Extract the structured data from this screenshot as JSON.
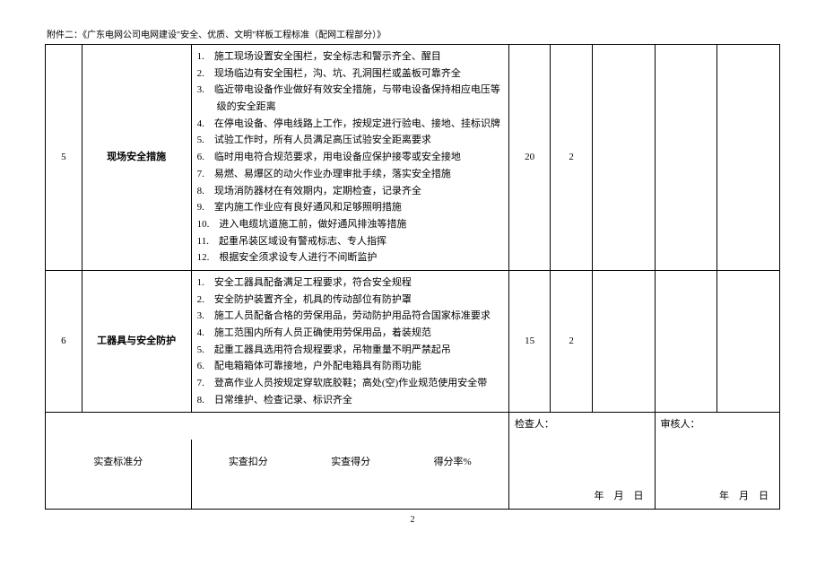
{
  "header": "附件二：《广东电网公司电网建设\"安全、优质、文明\"样板工程标准（配网工程部分）》",
  "rows": [
    {
      "idx": "5",
      "title": "现场安全措施",
      "items": [
        "施工现场设置安全围栏，安全标志和警示齐全、醒目",
        "现场临边有安全围栏，沟、坑、孔洞围栏或盖板可靠齐全",
        "临近带电设备作业做好有效安全措施，与带电设备保持相应电压等级的安全距离",
        "在停电设备、停电线路上工作，按规定进行验电、接地、挂标识牌",
        "试验工作时，所有人员满足高压试验安全距离要求",
        "临时用电符合规范要求，用电设备应保护接零或安全接地",
        "易燃、易爆区的动火作业办理审批手续，落实安全措施",
        "现场消防器材在有效期内，定期检查，记录齐全",
        "室内施工作业应有良好通风和足够照明措施",
        "进入电缆坑道施工前，做好通风排浊等措施",
        "起重吊装区域设有警戒标志、专人指挥",
        "根据安全须求设专人进行不间断监护"
      ],
      "score": "20",
      "min": "2"
    },
    {
      "idx": "6",
      "title": "工器具与安全防护",
      "items": [
        "安全工器具配备满足工程要求，符合安全规程",
        "安全防护装置齐全，机具的传动部位有防护罩",
        "施工人员配备合格的劳保用品，劳动防护用品符合国家标准要求",
        "施工范围内所有人员正确使用劳保用品，着装规范",
        "起重工器具选用符合规程要求，吊物重量不明严禁起吊",
        "配电箱箱体可靠接地，户外配电箱具有防雨功能",
        "登高作业人员按规定穿软底胶鞋；高处(空)作业规范使用安全带",
        "日常维护、检查记录、标识齐全"
      ],
      "score": "15",
      "min": "2"
    }
  ],
  "signatures": {
    "inspector_label": "检查人：",
    "auditor_label": "审核人："
  },
  "summary": {
    "std_score": "实查标准分",
    "deduct": "实查扣分",
    "got": "实查得分",
    "rate": "得分率%"
  },
  "date_text": "年　月　日",
  "page_number": "2"
}
